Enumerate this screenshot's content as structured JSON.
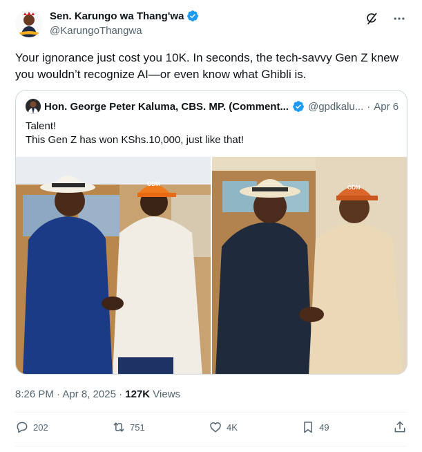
{
  "author": {
    "display_name": "Sen. Karungo wa Thang'wa",
    "handle": "@KarungoThangwa"
  },
  "tweet": {
    "text": "Your ignorance just cost you 10K. In seconds, the tech-savvy Gen Z knew you wouldn’t recognize AI—or even know what Ghibli is."
  },
  "quoted": {
    "display_name": "Hon. George Peter Kaluma, CBS. MP. (Comment...",
    "handle": "@gpdkalu...",
    "separator": "·",
    "date": "Apr 6",
    "line1": "Talent!",
    "line2": "This Gen Z has won KShs.10,000, just like that!",
    "cap_text": "ODM"
  },
  "meta": {
    "time": "8:26 PM · Apr 8, 2025 · ",
    "views_count": "127K",
    "views_label": " Views"
  },
  "actions": {
    "replies": "202",
    "reposts": "751",
    "likes": "4K",
    "bookmarks": "49"
  },
  "icons": {
    "verified": "verified-badge-icon",
    "grok": "grok-icon",
    "more": "more-icon",
    "reply": "reply-icon",
    "repost": "repost-icon",
    "like": "like-icon",
    "bookmark": "bookmark-icon",
    "share": "share-icon"
  },
  "colors": {
    "accent": "#1d9bf0",
    "text": "#0f1419",
    "muted": "#536471",
    "border": "#cfd9de"
  }
}
